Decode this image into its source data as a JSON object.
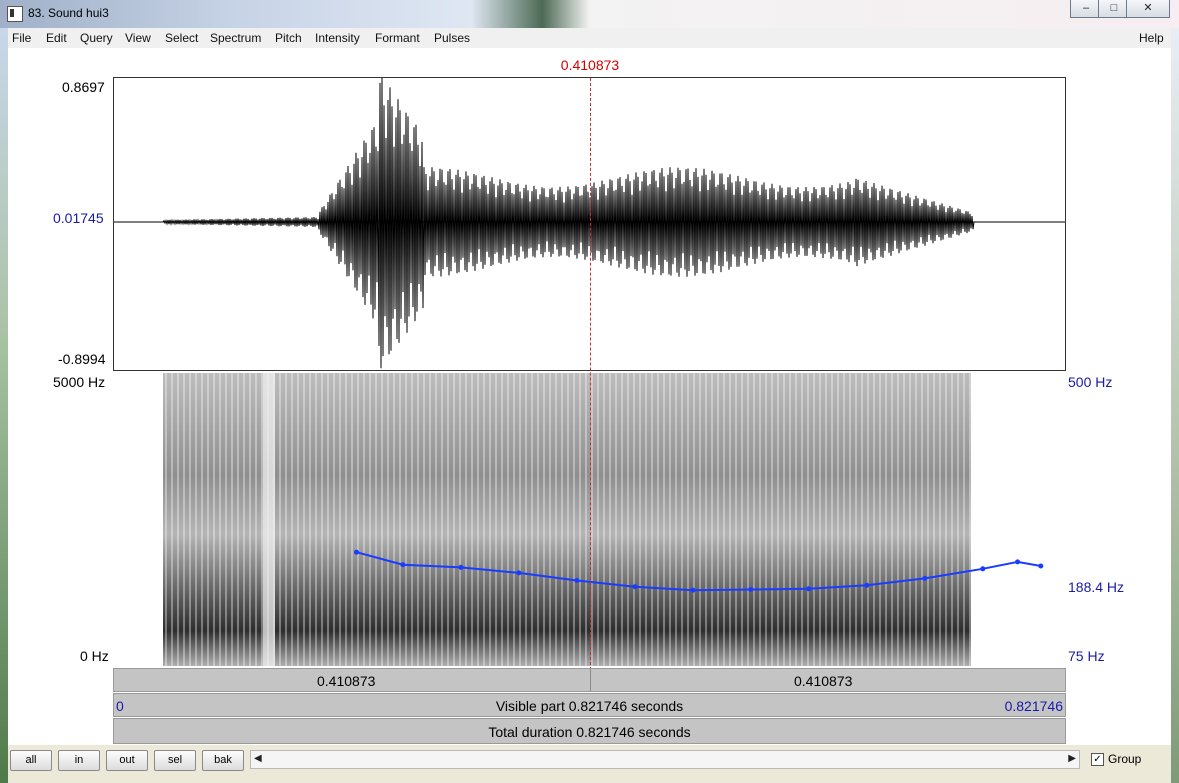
{
  "window": {
    "title": "83. Sound hui3",
    "controls": [
      "minimize",
      "maximize",
      "close"
    ]
  },
  "menu": [
    "File",
    "Edit",
    "Query",
    "View",
    "Select",
    "Spectrum",
    "Pitch",
    "Intensity",
    "Formant",
    "Pulses"
  ],
  "menu_help": "Help",
  "cursor_time": "0.410873",
  "waveform": {
    "y_max": "0.8697",
    "y_cursor": "0.01745",
    "y_min": "-0.8994"
  },
  "spectrogram": {
    "freq_top": "5000 Hz",
    "freq_bottom": "0 Hz",
    "pitch_top": "500 Hz",
    "pitch_value": "188.4 Hz",
    "pitch_bottom": "75 Hz",
    "pitch_color": "#1a3cff"
  },
  "time_bar": {
    "left": "0.410873",
    "right": "0.410873"
  },
  "visible_bar": {
    "start": "0",
    "label": "Visible part 0.821746 seconds",
    "end": "0.821746"
  },
  "total_bar": {
    "label": "Total duration 0.821746 seconds"
  },
  "buttons": [
    "all",
    "in",
    "out",
    "sel",
    "bak"
  ],
  "group": {
    "label": "Group",
    "checked": true
  },
  "chart_data": {
    "type": "line",
    "x": [
      0.21,
      0.25,
      0.3,
      0.35,
      0.4,
      0.45,
      0.5,
      0.55,
      0.6,
      0.65,
      0.7,
      0.75,
      0.78,
      0.8
    ],
    "series": [
      {
        "values": [
          240,
          222,
          218,
          210,
          199,
          190,
          185,
          186,
          187,
          192,
          202,
          216,
          226,
          220
        ]
      }
    ],
    "xlim": [
      0,
      0.821746
    ],
    "ylim": [
      75,
      500
    ]
  }
}
